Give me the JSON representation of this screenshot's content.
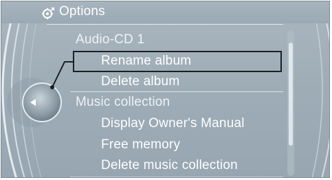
{
  "title": {
    "icon": "options-gear-icon",
    "text": "Options"
  },
  "menu": {
    "section_1": "Audio-CD 1",
    "items_1": [
      "Rename album",
      "Delete album"
    ],
    "section_2": "Music collection",
    "items_2": [
      "Display Owner's Manual",
      "Free memory",
      "Delete music collection"
    ],
    "selected_item": "Rename album"
  },
  "controller": {
    "icon": "controller-left-arrow-icon"
  },
  "colors": {
    "background": "#9fadb7",
    "text": "#ffffff",
    "highlight_border": "#1a1f23"
  }
}
